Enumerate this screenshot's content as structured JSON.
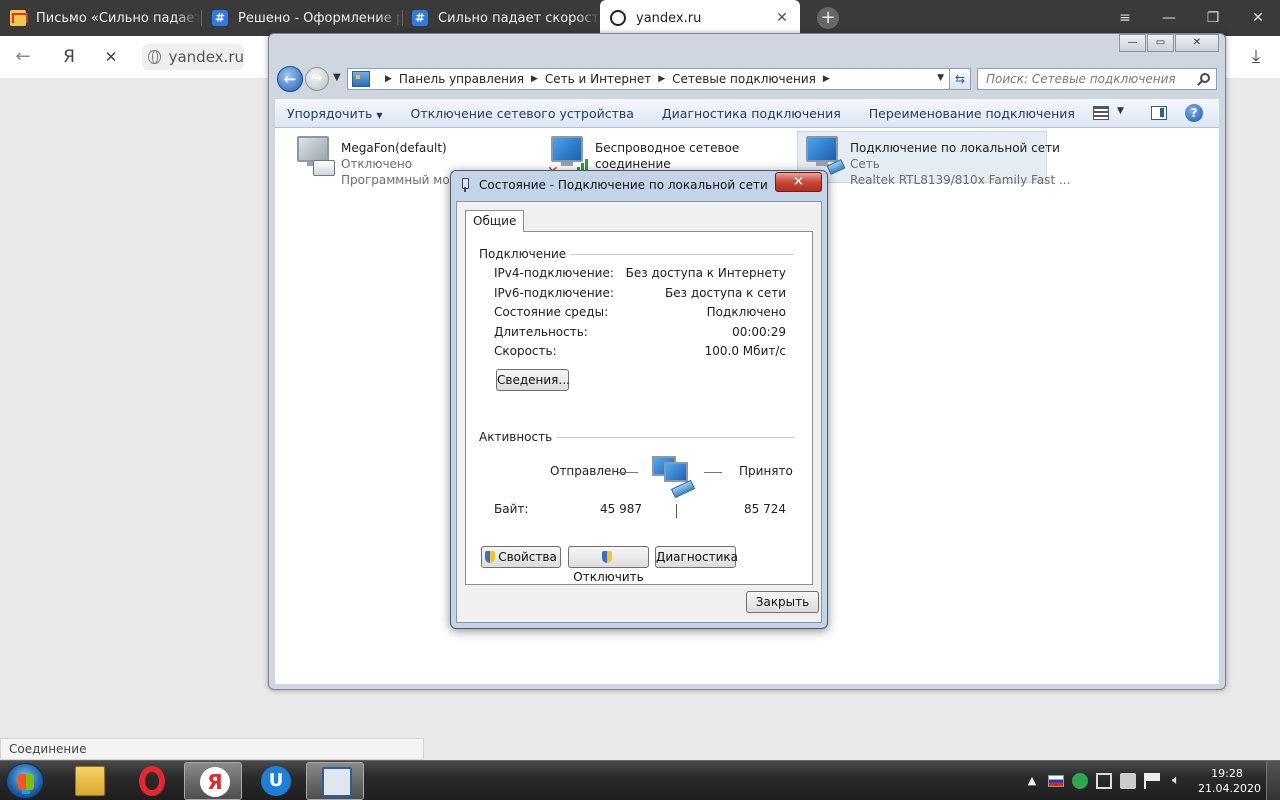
{
  "browser": {
    "tabs": [
      {
        "title": "Письмо «Сильно падает с",
        "icon": "mail-icon"
      },
      {
        "title": "Решено - Оформление ра",
        "icon": "forum-icon"
      },
      {
        "title": "Сильно падает скорость и",
        "icon": "forum-icon"
      },
      {
        "title": "yandex.ru",
        "icon": "loading-icon"
      }
    ],
    "active_tab": 3,
    "tab_close": "✕",
    "new_tab": "+",
    "window_controls": {
      "menu": "≡",
      "minimize": "—",
      "restore": "❐",
      "close": "✕"
    },
    "nav": {
      "back": "←",
      "yandex": "Я",
      "stop": "✕"
    },
    "url": "yandex.ru",
    "download": "⤓",
    "status_text": "Соединение"
  },
  "explorer": {
    "title_buttons": {
      "minimize": "—",
      "maximize": "▭",
      "close": "✕"
    },
    "breadcrumb": [
      "Панель управления",
      "Сеть и Интернет",
      "Сетевые подключения"
    ],
    "search_placeholder": "Поиск: Сетевые подключения",
    "toolbar": {
      "organize": "Упорядочить",
      "disable": "Отключение сетевого устройства",
      "diagnose": "Диагностика подключения",
      "rename": "Переименование подключения",
      "more": "»"
    },
    "connections": [
      {
        "name": "MegaFon(default)",
        "status": "Отключено",
        "device": "Программный мод"
      },
      {
        "name": "Беспроводное сетевое",
        "status": "соединение",
        "device": ""
      },
      {
        "name": "Подключение по локальной сети",
        "status": "Сеть",
        "device": "Realtek RTL8139/810x Family Fast ..."
      }
    ]
  },
  "dialog": {
    "title": "Состояние - Подключение по локальной сети",
    "close": "✕",
    "tab": "Общие",
    "connection_group": "Подключение",
    "rows": [
      {
        "label": "IPv4-подключение:",
        "value": "Без доступа к Интернету"
      },
      {
        "label": "IPv6-подключение:",
        "value": "Без доступа к сети"
      },
      {
        "label": "Состояние среды:",
        "value": "Подключено"
      },
      {
        "label": "Длительность:",
        "value": "00:00:29"
      },
      {
        "label": "Скорость:",
        "value": "100.0 Мбит/с"
      }
    ],
    "details_button": "Сведения...",
    "activity_group": "Активность",
    "sent_label": "Отправлено",
    "received_label": "Принято",
    "bytes_label": "Байт:",
    "bytes_sent": "45 987",
    "bytes_received": "85 724",
    "properties_button": "Свойства",
    "disconnect_button": "Отключить",
    "diagnose_button": "Диагностика",
    "close_button": "Закрыть"
  },
  "taskbar": {
    "clock_time": "19:28",
    "clock_date": "21.04.2020",
    "tray_icons": [
      "show-hidden-icon",
      "language-ru-icon",
      "app-icon",
      "network-icon",
      "device-icon",
      "flag-icon",
      "volume-icon"
    ],
    "tray_arrow": "▲",
    "yandex_glyph": "Я",
    "u_glyph": "U"
  },
  "colors": {
    "accent": "#1d5ea8",
    "load_bar": "#f6b800",
    "dialog_frame": "#c4d4e8",
    "close_red": "#c9473a"
  }
}
